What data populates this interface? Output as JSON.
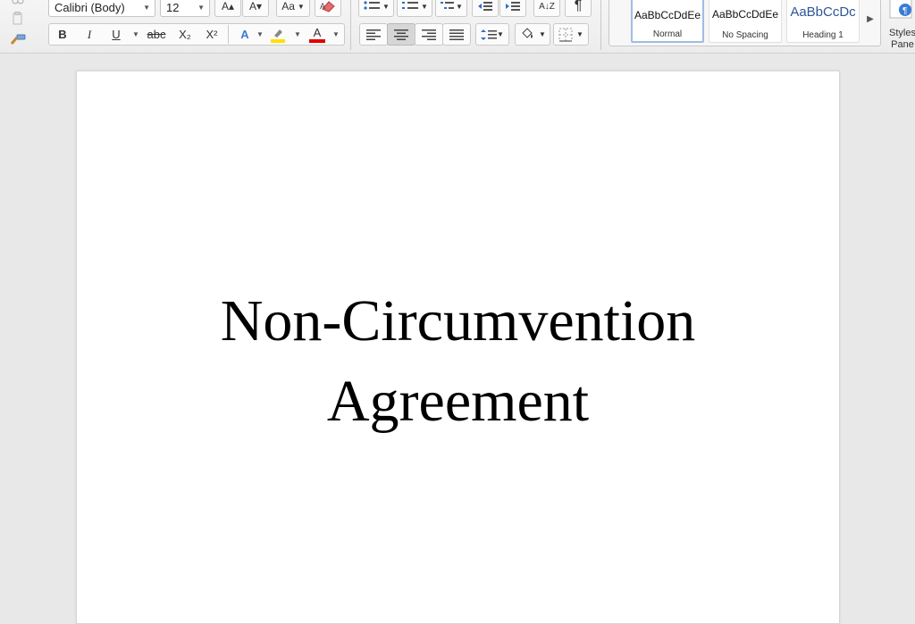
{
  "toolbar": {
    "font_name": "Calibri (Body)",
    "font_size": "12",
    "bold_label": "B",
    "italic_label": "I",
    "underline_label": "U",
    "strikethrough_label": "abc",
    "subscript_label": "X₂",
    "superscript_label": "X²",
    "text_effects_label": "A",
    "font_color_label": "A",
    "grow_font_label": "A▴",
    "shrink_font_label": "A▾",
    "change_case_label": "Aa",
    "sort_label": "A↓Z",
    "pilcrow_label": "¶",
    "highlight_color": "#ffe000",
    "font_color": "#e00000"
  },
  "styles": {
    "items": [
      {
        "sample": "AaBbCcDdEe",
        "name": "Normal"
      },
      {
        "sample": "AaBbCcDdEe",
        "name": "No Spacing"
      },
      {
        "sample": "AaBbCcDc",
        "name": "Heading 1"
      }
    ],
    "pane_label_line1": "Styles",
    "pane_label_line2": "Pane",
    "heading_color": "#2f5597"
  },
  "document": {
    "title_line1": "Non-Circumvention",
    "title_line2": "Agreement"
  }
}
